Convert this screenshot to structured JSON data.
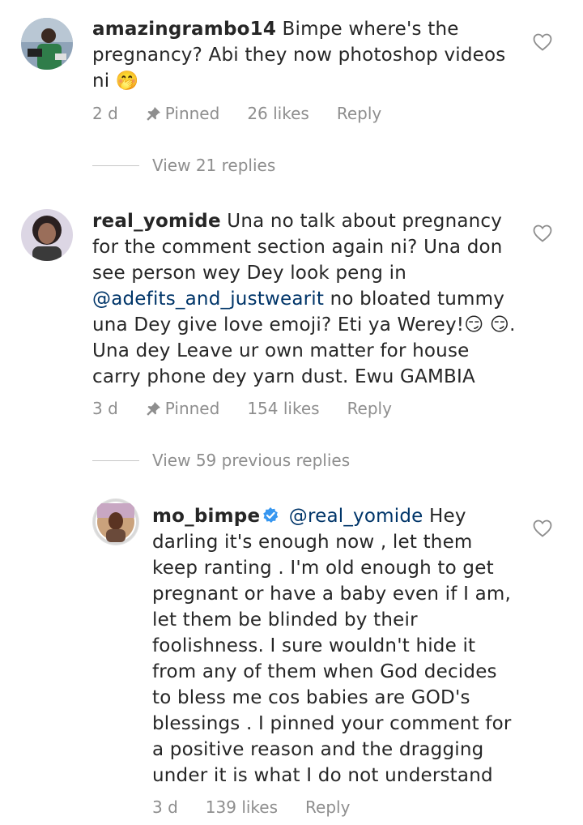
{
  "comments": [
    {
      "username": "amazingrambo14",
      "text": "Bimpe where's the pregnancy? Abi they now photoshop videos ni",
      "emoji": "🤭",
      "age": "2 d",
      "pinned_label": "Pinned",
      "likes": "26 likes",
      "reply_label": "Reply",
      "view_replies": "View 21 replies"
    },
    {
      "username": "real_yomide",
      "text_part1": "Una no talk about pregnancy for the comment section again ni? Una don see person wey Dey look peng in",
      "mention": "@adefits_and_justwearit",
      "text_part2": "no bloated tummy una Dey give love emoji? Eti ya Werey!",
      "emoji1": "😏",
      "emoji2": "😏",
      "text_part3": ". Una dey Leave ur own matter for house carry phone dey yarn dust. Ewu GAMBIA",
      "age": "3 d",
      "pinned_label": "Pinned",
      "likes": "154 likes",
      "reply_label": "Reply",
      "view_replies": "View 59 previous replies"
    }
  ],
  "reply": {
    "username": "mo_bimpe",
    "verified": true,
    "mention": "@real_yomide",
    "text": "Hey darling it's enough now , let them keep ranting . I'm old enough to get pregnant or have a baby even if I am, let them be blinded by their foolishness. I sure wouldn't hide it from any of them when God decides to bless me cos babies are GOD's blessings . I pinned your comment for a positive reason and the dragging under it is what I do not understand",
    "age": "3 d",
    "likes": "139 likes",
    "reply_label": "Reply"
  },
  "colors": {
    "text": "#262626",
    "secondary": "#8e8e8e",
    "mention": "#003569",
    "verified": "#3897f0"
  },
  "icons": [
    "heart-outline-icon",
    "pin-icon",
    "verified-badge-icon"
  ]
}
